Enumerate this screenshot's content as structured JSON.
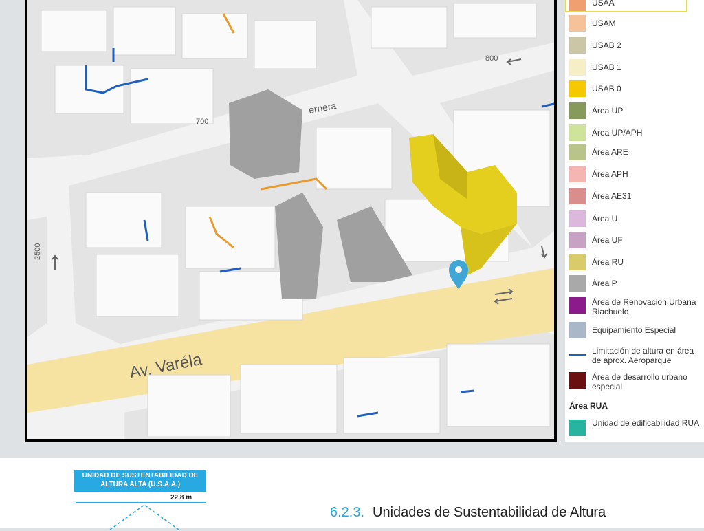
{
  "map": {
    "streets": {
      "av_varela": "Av. Varéla",
      "top_street": "ernera",
      "number_700": "700",
      "number_800": "800",
      "number_2500": "2500"
    },
    "colors": {
      "road": "#f6e3a2",
      "block": "#e4e4e4",
      "building": "#fafafa",
      "tall_building": "#9c9c9c",
      "highlight": "#e4cf1e",
      "pin": "#3fa6d6"
    },
    "icons": [
      "location-pin-icon",
      "one-way-arrow-icon",
      "two-way-arrow-icon"
    ]
  },
  "legend": {
    "items": [
      {
        "label": "USAA",
        "color": "#f0a070"
      },
      {
        "label": "USAM",
        "color": "#f6c299"
      },
      {
        "label": "USAB 2",
        "color": "#cbc7a6"
      },
      {
        "label": "USAB 1",
        "color": "#f5eec6"
      },
      {
        "label": "USAB 0",
        "color": "#f5c800"
      },
      {
        "label": "Área UP",
        "color": "#869a5c"
      },
      {
        "label": "Área UP/APH",
        "color": "#cde49a"
      },
      {
        "label": "Área ARE",
        "color": "#b8c48a"
      },
      {
        "label": "Área APH",
        "color": "#f4b5b3"
      },
      {
        "label": "Área AE31",
        "color": "#d98d8d"
      },
      {
        "label": "Área U",
        "color": "#dcb8dd"
      },
      {
        "label": "Área UF",
        "color": "#c7a2c2"
      },
      {
        "label": "Área RU",
        "color": "#d9cb6a"
      },
      {
        "label": "Área P",
        "color": "#a9a9a9"
      },
      {
        "label": "Área de Renovacion Urbana Riachuelo",
        "color": "#8b1a8b"
      },
      {
        "label": "Equipamiento Especial",
        "color": "#a9b7c9"
      },
      {
        "label": "Limitación de altura en área de aprox. Aeroparque",
        "color": "#1f5fbf"
      },
      {
        "label": "Área de desarrollo urbano especial",
        "color": "#6a1010"
      }
    ],
    "rua_heading": "Área RUA",
    "rua_items": [
      {
        "label": "Unidad de edificabilidad RUA",
        "color": "#27b5a0"
      }
    ]
  },
  "document": {
    "badge": "UNIDAD DE SUSTENTABILIDAD DE ALTURA ALTA (U.S.A.A.)",
    "height": "22,8 m",
    "section_number": "6.2.3.",
    "section_title": "Unidades de Sustentabilidad de Altura"
  }
}
